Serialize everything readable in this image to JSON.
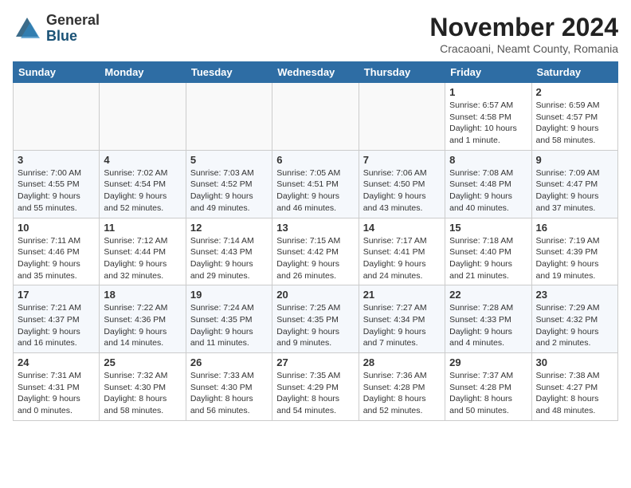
{
  "logo": {
    "general": "General",
    "blue": "Blue"
  },
  "title": "November 2024",
  "subtitle": "Cracaoani, Neamt County, Romania",
  "weekdays": [
    "Sunday",
    "Monday",
    "Tuesday",
    "Wednesday",
    "Thursday",
    "Friday",
    "Saturday"
  ],
  "weeks": [
    [
      {
        "day": "",
        "info": ""
      },
      {
        "day": "",
        "info": ""
      },
      {
        "day": "",
        "info": ""
      },
      {
        "day": "",
        "info": ""
      },
      {
        "day": "",
        "info": ""
      },
      {
        "day": "1",
        "info": "Sunrise: 6:57 AM\nSunset: 4:58 PM\nDaylight: 10 hours and 1 minute."
      },
      {
        "day": "2",
        "info": "Sunrise: 6:59 AM\nSunset: 4:57 PM\nDaylight: 9 hours and 58 minutes."
      }
    ],
    [
      {
        "day": "3",
        "info": "Sunrise: 7:00 AM\nSunset: 4:55 PM\nDaylight: 9 hours and 55 minutes."
      },
      {
        "day": "4",
        "info": "Sunrise: 7:02 AM\nSunset: 4:54 PM\nDaylight: 9 hours and 52 minutes."
      },
      {
        "day": "5",
        "info": "Sunrise: 7:03 AM\nSunset: 4:52 PM\nDaylight: 9 hours and 49 minutes."
      },
      {
        "day": "6",
        "info": "Sunrise: 7:05 AM\nSunset: 4:51 PM\nDaylight: 9 hours and 46 minutes."
      },
      {
        "day": "7",
        "info": "Sunrise: 7:06 AM\nSunset: 4:50 PM\nDaylight: 9 hours and 43 minutes."
      },
      {
        "day": "8",
        "info": "Sunrise: 7:08 AM\nSunset: 4:48 PM\nDaylight: 9 hours and 40 minutes."
      },
      {
        "day": "9",
        "info": "Sunrise: 7:09 AM\nSunset: 4:47 PM\nDaylight: 9 hours and 37 minutes."
      }
    ],
    [
      {
        "day": "10",
        "info": "Sunrise: 7:11 AM\nSunset: 4:46 PM\nDaylight: 9 hours and 35 minutes."
      },
      {
        "day": "11",
        "info": "Sunrise: 7:12 AM\nSunset: 4:44 PM\nDaylight: 9 hours and 32 minutes."
      },
      {
        "day": "12",
        "info": "Sunrise: 7:14 AM\nSunset: 4:43 PM\nDaylight: 9 hours and 29 minutes."
      },
      {
        "day": "13",
        "info": "Sunrise: 7:15 AM\nSunset: 4:42 PM\nDaylight: 9 hours and 26 minutes."
      },
      {
        "day": "14",
        "info": "Sunrise: 7:17 AM\nSunset: 4:41 PM\nDaylight: 9 hours and 24 minutes."
      },
      {
        "day": "15",
        "info": "Sunrise: 7:18 AM\nSunset: 4:40 PM\nDaylight: 9 hours and 21 minutes."
      },
      {
        "day": "16",
        "info": "Sunrise: 7:19 AM\nSunset: 4:39 PM\nDaylight: 9 hours and 19 minutes."
      }
    ],
    [
      {
        "day": "17",
        "info": "Sunrise: 7:21 AM\nSunset: 4:37 PM\nDaylight: 9 hours and 16 minutes."
      },
      {
        "day": "18",
        "info": "Sunrise: 7:22 AM\nSunset: 4:36 PM\nDaylight: 9 hours and 14 minutes."
      },
      {
        "day": "19",
        "info": "Sunrise: 7:24 AM\nSunset: 4:35 PM\nDaylight: 9 hours and 11 minutes."
      },
      {
        "day": "20",
        "info": "Sunrise: 7:25 AM\nSunset: 4:35 PM\nDaylight: 9 hours and 9 minutes."
      },
      {
        "day": "21",
        "info": "Sunrise: 7:27 AM\nSunset: 4:34 PM\nDaylight: 9 hours and 7 minutes."
      },
      {
        "day": "22",
        "info": "Sunrise: 7:28 AM\nSunset: 4:33 PM\nDaylight: 9 hours and 4 minutes."
      },
      {
        "day": "23",
        "info": "Sunrise: 7:29 AM\nSunset: 4:32 PM\nDaylight: 9 hours and 2 minutes."
      }
    ],
    [
      {
        "day": "24",
        "info": "Sunrise: 7:31 AM\nSunset: 4:31 PM\nDaylight: 9 hours and 0 minutes."
      },
      {
        "day": "25",
        "info": "Sunrise: 7:32 AM\nSunset: 4:30 PM\nDaylight: 8 hours and 58 minutes."
      },
      {
        "day": "26",
        "info": "Sunrise: 7:33 AM\nSunset: 4:30 PM\nDaylight: 8 hours and 56 minutes."
      },
      {
        "day": "27",
        "info": "Sunrise: 7:35 AM\nSunset: 4:29 PM\nDaylight: 8 hours and 54 minutes."
      },
      {
        "day": "28",
        "info": "Sunrise: 7:36 AM\nSunset: 4:28 PM\nDaylight: 8 hours and 52 minutes."
      },
      {
        "day": "29",
        "info": "Sunrise: 7:37 AM\nSunset: 4:28 PM\nDaylight: 8 hours and 50 minutes."
      },
      {
        "day": "30",
        "info": "Sunrise: 7:38 AM\nSunset: 4:27 PM\nDaylight: 8 hours and 48 minutes."
      }
    ]
  ]
}
